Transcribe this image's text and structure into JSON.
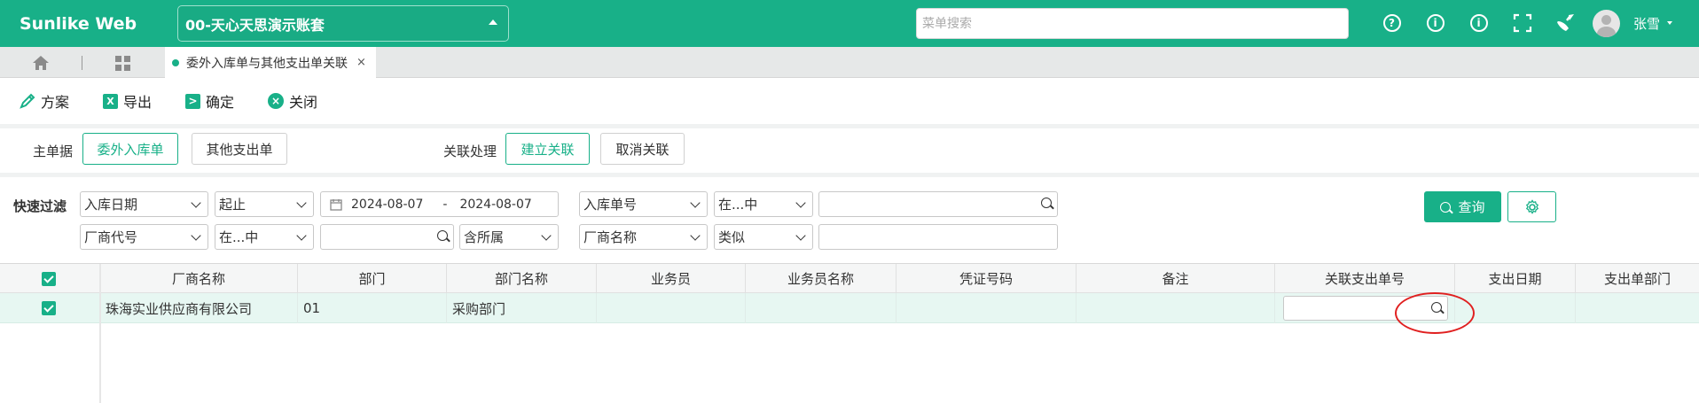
{
  "header": {
    "brand": "Sunlike Web",
    "account": "00-天心天思演示账套",
    "search_placeholder": "菜单搜索",
    "username": "张雪",
    "icons": [
      "help-icon",
      "info-icon",
      "about-icon",
      "fullscreen-icon",
      "broom-icon"
    ]
  },
  "tabs": {
    "active_tab": "委外入库单与其他支出单关联",
    "close": "×"
  },
  "toolbar": {
    "scheme": "方案",
    "export": "导出",
    "confirm": "确定",
    "close": "关闭",
    "export_glyph": "X",
    "confirm_glyph": ">",
    "close_glyph": "×"
  },
  "relation": {
    "main_doc_label": "主单据",
    "doc_a": "委外入库单",
    "doc_b": "其他支出单",
    "process_label": "关联处理",
    "link": "建立关联",
    "unlink": "取消关联"
  },
  "filter": {
    "label": "快速过滤",
    "field1": "入库日期",
    "op1": "起止",
    "date_from": "2024-08-07",
    "date_sep": "-",
    "date_to": "2024-08-07",
    "field2": "入库单号",
    "op2": "在...中",
    "field3": "厂商代号",
    "op3": "在...中",
    "op3b": "含所属",
    "field4": "厂商名称",
    "op4": "类似",
    "query": "查询"
  },
  "table": {
    "columns": [
      "厂商名称",
      "部门",
      "部门名称",
      "业务员",
      "业务员名称",
      "凭证号码",
      "备注",
      "关联支出单号",
      "支出日期",
      "支出单部门"
    ],
    "rows": [
      {
        "vendor_name": "珠海实业供应商有限公司",
        "dept": "01",
        "dept_name": "采购部门",
        "salesman": "",
        "salesman_name": "",
        "voucher": "",
        "remark": "",
        "linked_no": "",
        "pay_date": "",
        "pay_dept": ""
      }
    ]
  },
  "colors": {
    "accent": "#18b088",
    "highlight": "#e02020"
  }
}
